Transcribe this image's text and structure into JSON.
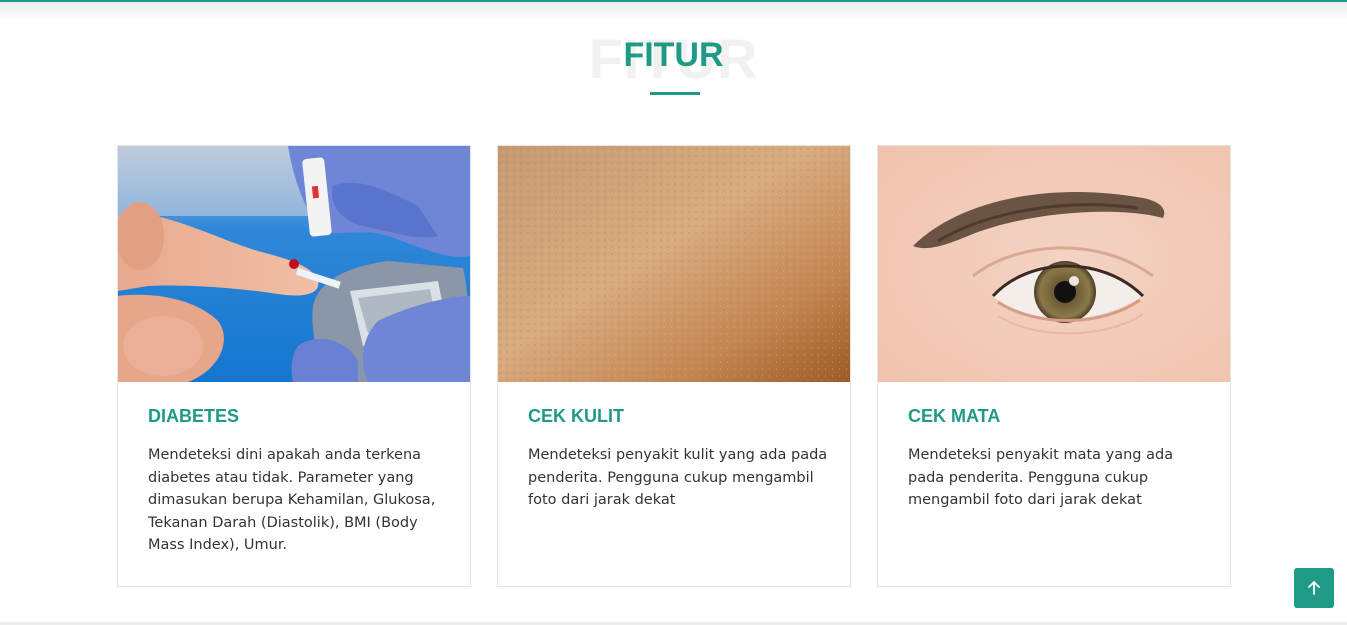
{
  "section": {
    "title": "FITUR",
    "title_background": "FITUR"
  },
  "colors": {
    "accent": "#1f9a86"
  },
  "cards": [
    {
      "image": "blood-glucose-test-photo",
      "title": "DIABETES",
      "text": "Mendeteksi dini apakah anda terkena diabetes atau tidak. Parameter yang dimasukan berupa Kehamilan, Glukosa, Tekanan Darah (Diastolik), BMI (Body Mass Index), Umur."
    },
    {
      "image": "skin-closeup-photo",
      "title": "CEK KULIT",
      "text": "Mendeteksi penyakit kulit yang ada pada penderita. Pengguna cukup mengambil foto dari jarak dekat"
    },
    {
      "image": "eye-closeup-photo",
      "title": "CEK MATA",
      "text": "Mendeteksi penyakit mata yang ada pada penderita. Pengguna cukup mengambil foto dari jarak dekat"
    }
  ],
  "back_to_top": {
    "icon": "arrow-up-icon"
  }
}
